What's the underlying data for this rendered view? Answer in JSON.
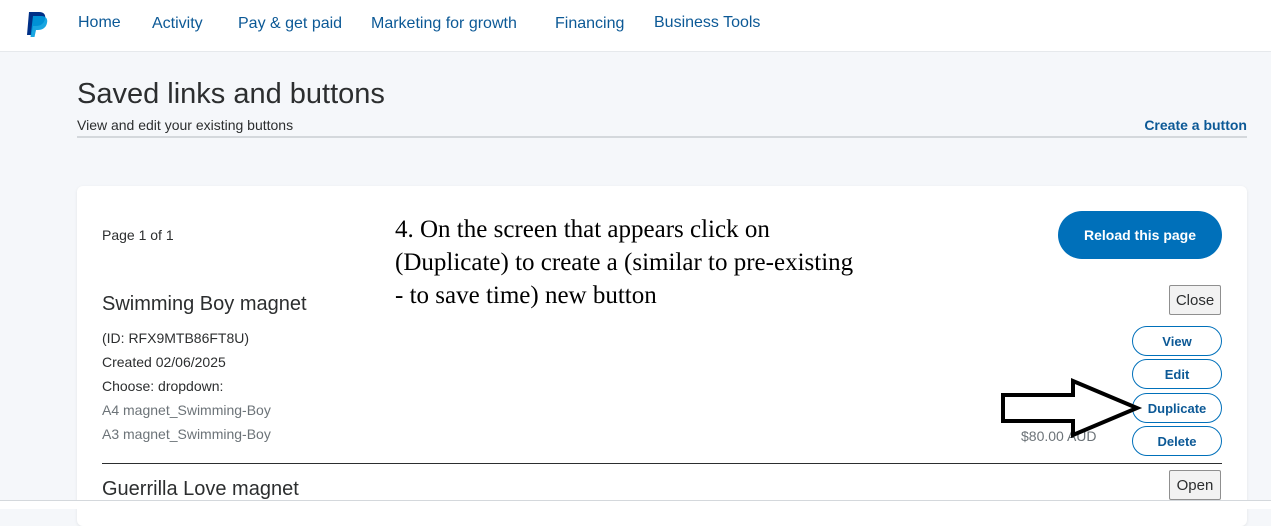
{
  "nav": {
    "items": [
      "Home",
      "Activity",
      "Pay & get paid",
      "Marketing for growth",
      "Financing",
      "Business Tools"
    ]
  },
  "header": {
    "title": "Saved links and buttons",
    "subtitle": "View and edit your existing buttons",
    "create_link": "Create a button"
  },
  "card": {
    "page_indicator": "Page 1 of 1",
    "reload_label": "Reload this page",
    "items": [
      {
        "title": "Swimming Boy magnet",
        "id_line": "(ID: RFX9MTB86FT8U)",
        "created": "Created 02/06/2025",
        "choose": "Choose: dropdown:",
        "options": [
          "A4 magnet_Swimming-Boy",
          "A3 magnet_Swimming-Boy"
        ],
        "price": "$80.00 AUD",
        "toggle_label": "Close",
        "actions": [
          "View",
          "Edit",
          "Duplicate",
          "Delete"
        ]
      },
      {
        "title": "Guerrilla Love magnet",
        "toggle_label": "Open"
      }
    ]
  },
  "annotation": {
    "text": "4. On the screen that appears click on (Duplicate) to create  a (similar to pre-existing - to save time) new button"
  },
  "colors": {
    "link": "#0c5996",
    "primary": "#0070ba",
    "background": "#f5f7fa"
  }
}
